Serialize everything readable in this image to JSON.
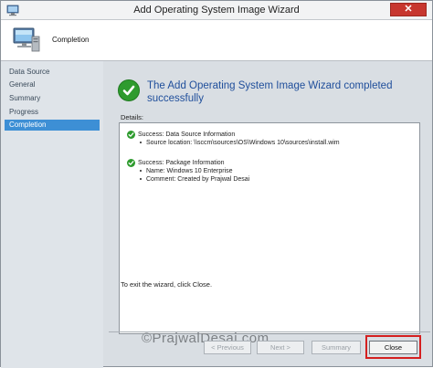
{
  "window": {
    "title": "Add Operating System Image Wizard",
    "close_glyph": "✕"
  },
  "header": {
    "title": "Completion",
    "icon": "computer-icon"
  },
  "sidebar": {
    "items": [
      {
        "label": "Data Source",
        "active": false
      },
      {
        "label": "General",
        "active": false
      },
      {
        "label": "Summary",
        "active": false
      },
      {
        "label": "Progress",
        "active": false
      },
      {
        "label": "Completion",
        "active": true
      }
    ]
  },
  "main": {
    "headline_line1": "The Add Operating System Image Wizard completed",
    "headline_line2": "successfully",
    "details_label": "Details:",
    "details": [
      {
        "title": "Success: Data Source Information",
        "lines": [
          "Source location: \\\\sccm\\sources\\OS\\Windows 10\\sources\\install.wim"
        ]
      },
      {
        "title": "Success: Package Information",
        "lines": [
          "Name: Windows 10 Enterprise",
          "Comment: Created by Prajwal Desai"
        ]
      }
    ],
    "exit_text": "To exit the wizard, click Close."
  },
  "buttons": {
    "previous": "< Previous",
    "next": "Next >",
    "summary": "Summary",
    "close": "Close"
  },
  "watermark": "©PrajwalDesai.com",
  "colors": {
    "accent": "#3d8fd5",
    "headline": "#1f4e9b",
    "success": "#2e9b2e",
    "highlight": "#d42020",
    "close_box": "#c7372f"
  }
}
